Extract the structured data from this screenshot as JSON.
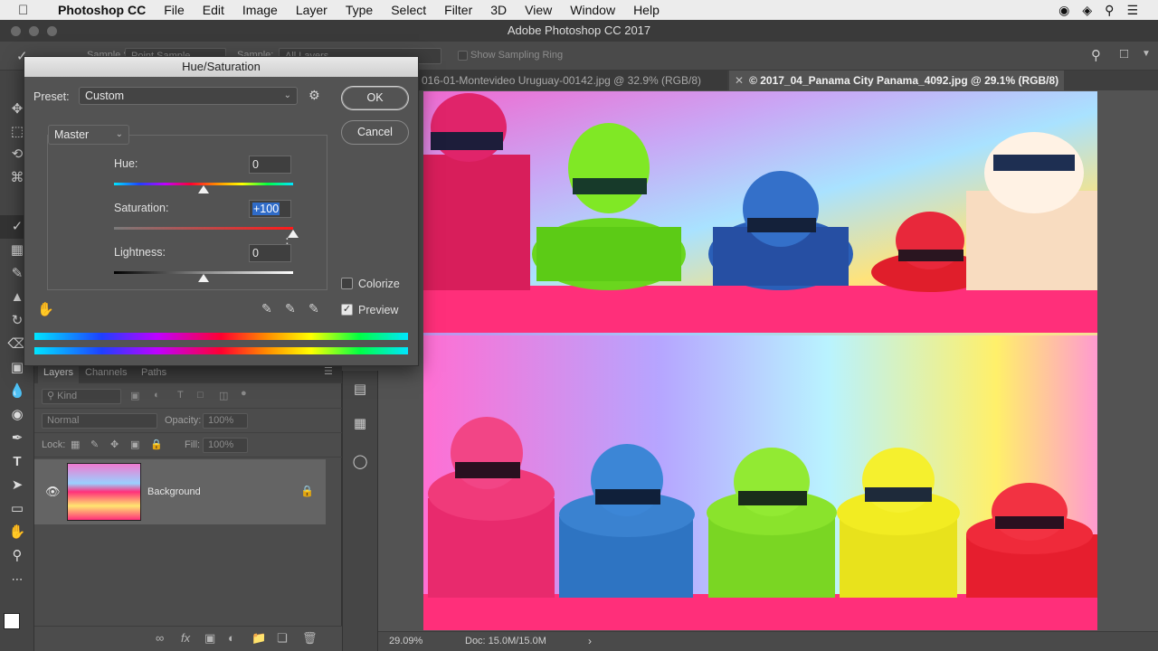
{
  "menubar": {
    "app_name": "Photoshop CC",
    "items": [
      "File",
      "Edit",
      "Image",
      "Layer",
      "Type",
      "Select",
      "Filter",
      "3D",
      "View",
      "Window",
      "Help"
    ]
  },
  "window": {
    "title": "Adobe Photoshop CC 2017"
  },
  "options_bar": {
    "sample_size_label": "Sample Size:",
    "sample_size_value": "Point Sample",
    "sample_label": "Sample:",
    "sample_value": "All Layers",
    "show_sampling_ring": "Show Sampling Ring"
  },
  "tabs": [
    {
      "label": "016-01-Montevideo Uruguay-00142.jpg @ 32.9% (RGB/8)",
      "active": false
    },
    {
      "label": "© 2017_04_Panama City Panama_4092.jpg @ 29.1% (RGB/8)",
      "active": true
    }
  ],
  "dialog": {
    "title": "Hue/Saturation",
    "preset_label": "Preset:",
    "preset_value": "Custom",
    "channel_value": "Master",
    "ok_label": "OK",
    "cancel_label": "Cancel",
    "hue": {
      "label": "Hue:",
      "value": "0",
      "level": 0.5
    },
    "saturation": {
      "label": "Saturation:",
      "value": "+100",
      "level": 1.0
    },
    "lightness": {
      "label": "Lightness:",
      "value": "0",
      "level": 0.5
    },
    "colorize_label": "Colorize",
    "colorize_checked": false,
    "preview_label": "Preview",
    "preview_checked": true
  },
  "layers_panel": {
    "tabs": [
      "Layers",
      "Channels",
      "Paths"
    ],
    "kind_label": "Kind",
    "blend_mode": "Normal",
    "opacity_label": "Opacity:",
    "opacity_value": "100%",
    "lock_label": "Lock:",
    "fill_label": "Fill:",
    "fill_value": "100%",
    "layer_name": "Background"
  },
  "statusbar": {
    "zoom": "29.09%",
    "doc": "Doc: 15.0M/15.0M"
  }
}
